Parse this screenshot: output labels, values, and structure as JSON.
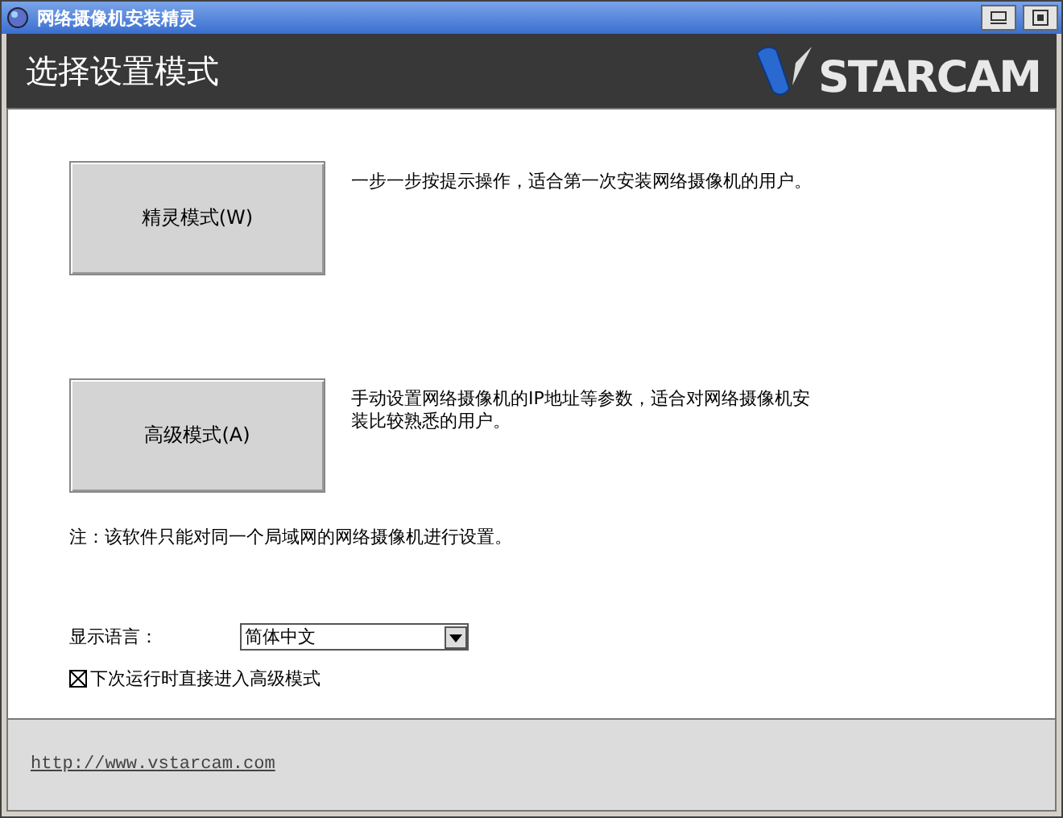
{
  "window": {
    "title": "网络摄像机安装精灵"
  },
  "header": {
    "title": "选择设置模式",
    "logo_text": "STARCAM"
  },
  "modes": [
    {
      "label": "精灵模式(W)",
      "description": "一步一步按提示操作，适合第一次安装网络摄像机的用户。"
    },
    {
      "label": "高级模式(A)",
      "description": "手动设置网络摄像机的IP地址等参数，适合对网络摄像机安装比较熟悉的用户。"
    }
  ],
  "note": "注：该软件只能对同一个局域网的网络摄像机进行设置。",
  "language": {
    "label": "显示语言：",
    "value": "简体中文"
  },
  "advanced_next_time": {
    "label": "下次运行时直接进入高级模式",
    "checked": true
  },
  "footer": {
    "link": "http://www.vstarcam.com"
  }
}
